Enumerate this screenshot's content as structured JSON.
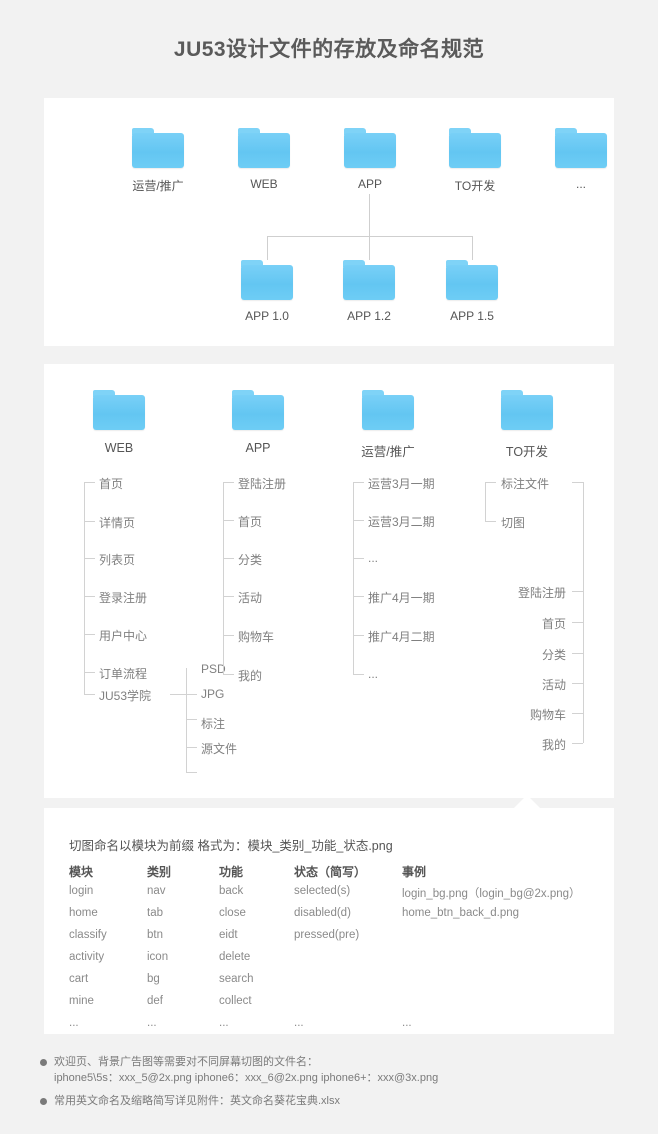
{
  "page": {
    "title": "JU53设计文件的存放及命名规范",
    "background_color": "#f2f2f2",
    "card_color": "#ffffff",
    "folder_color": "#6ecdf5",
    "line_color": "#d2d2d2",
    "text_color": "#808080"
  },
  "structure_card": {
    "level1": [
      {
        "label": "运营/推广"
      },
      {
        "label": "WEB"
      },
      {
        "label": "APP"
      },
      {
        "label": "TO开发"
      },
      {
        "label": "..."
      }
    ],
    "level2": [
      {
        "label": "APP 1.0"
      },
      {
        "label": "APP 1.2"
      },
      {
        "label": "APP 1.5"
      }
    ]
  },
  "tree_card": {
    "columns": [
      {
        "title": "WEB",
        "items": [
          "首页",
          "详情页",
          "列表页",
          "登录注册",
          "用户中心",
          "订单流程",
          "JU53学院"
        ],
        "sub_items": [
          "PSD",
          "JPG",
          "标注",
          "源文件"
        ]
      },
      {
        "title": "APP",
        "items": [
          "登陆注册",
          "首页",
          "分类",
          "活动",
          "购物车",
          "我的"
        ]
      },
      {
        "title": "运营/推广",
        "items": [
          "运营3月一期",
          "运营3月二期",
          "...",
          "推广4月一期",
          "推广4月二期",
          "..."
        ]
      },
      {
        "title": "TO开发",
        "items": [
          "标注文件",
          "切图"
        ],
        "right_items": [
          "登陆注册",
          "首页",
          "分类",
          "活动",
          "购物车",
          "我的"
        ]
      }
    ]
  },
  "naming_card": {
    "heading": "切图命名以模块为前缀 格式为：模块_类别_功能_状态.png",
    "headers": [
      "模块",
      "类别",
      "功能",
      "状态（简写）",
      "事例"
    ],
    "rows": [
      [
        "login",
        "nav",
        "back",
        "selected(s)",
        "login_bg.png（login_bg@2x.png）"
      ],
      [
        "home",
        "tab",
        "close",
        "disabled(d)",
        "home_btn_back_d.png"
      ],
      [
        "classify",
        "btn",
        "eidt",
        "pressed(pre)",
        ""
      ],
      [
        "activity",
        "icon",
        "delete",
        "",
        ""
      ],
      [
        "cart",
        "bg",
        "search",
        "",
        ""
      ],
      [
        "mine",
        "def",
        "collect",
        "",
        ""
      ],
      [
        "...",
        "...",
        "...",
        "...",
        "..."
      ]
    ]
  },
  "footer": {
    "notes": [
      {
        "line1": "欢迎页、背景广告图等需要对不同屏幕切图的文件名：",
        "line2": "iphone5\\5s：xxx_5@2x.png    iphone6：xxx_6@2x.png    iphone6+：xxx@3x.png"
      },
      {
        "line1": "常用英文命名及缩略简写详见附件：英文命名葵花宝典.xlsx",
        "line2": ""
      }
    ]
  }
}
